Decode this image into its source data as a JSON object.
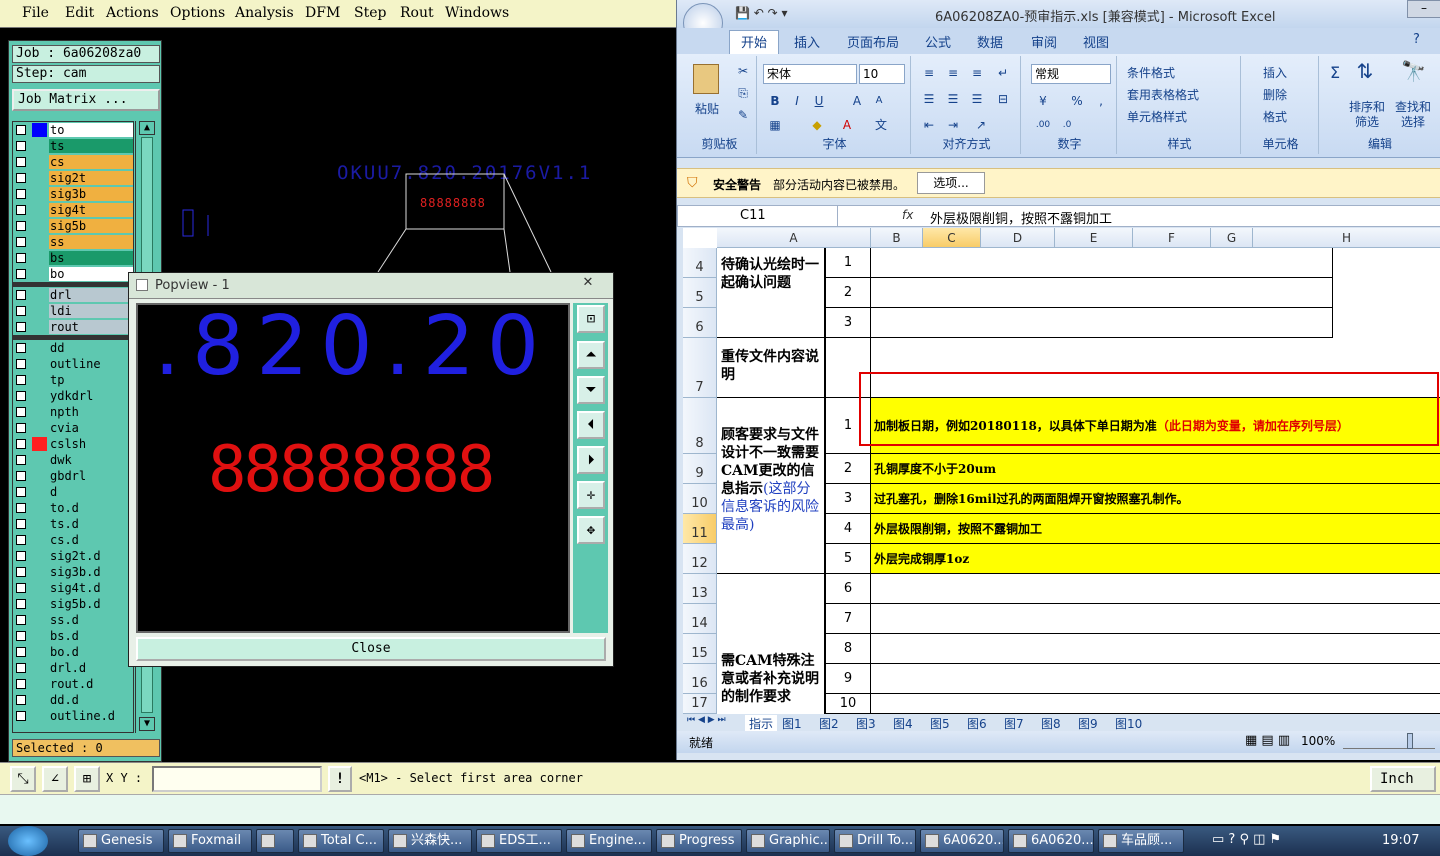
{
  "genesis": {
    "menu": [
      "File",
      "Edit",
      "Actions",
      "Options",
      "Analysis",
      "DFM",
      "Step",
      "Rout",
      "Windows"
    ],
    "job_label": "Job : 6a06208za0",
    "step_label": "Step: cam",
    "job_matrix_button": "Job Matrix ...",
    "layers": [
      {
        "name": "to",
        "color": "#ffffff",
        "marker": "#0000ff"
      },
      {
        "name": "ts",
        "color": "#1a9a6a"
      },
      {
        "name": "cs",
        "color": "#f0b040"
      },
      {
        "name": "sig2t",
        "color": "#f0b040"
      },
      {
        "name": "sig3b",
        "color": "#f0b040"
      },
      {
        "name": "sig4t",
        "color": "#f0b040"
      },
      {
        "name": "sig5b",
        "color": "#f0b040"
      },
      {
        "name": "ss",
        "color": "#f0b040"
      },
      {
        "name": "bs",
        "color": "#1a9a6a"
      },
      {
        "name": "bo",
        "color": "#ffffff"
      },
      {
        "name": "drl",
        "color": "#b8c8d0"
      },
      {
        "name": "ldi",
        "color": "#b8c8d0"
      },
      {
        "name": "rout",
        "color": "#b8c8d0"
      },
      {
        "name": "dd",
        "color": "#5ec8b0"
      },
      {
        "name": "outline",
        "color": "#5ec8b0"
      },
      {
        "name": "tp",
        "color": "#5ec8b0"
      },
      {
        "name": "ydkdrl",
        "color": "#5ec8b0"
      },
      {
        "name": "npth",
        "color": "#5ec8b0"
      },
      {
        "name": "cvia",
        "color": "#5ec8b0"
      },
      {
        "name": "cslsh",
        "color": "#5ec8b0",
        "marker": "#ff2020"
      },
      {
        "name": "dwk",
        "color": "#5ec8b0"
      },
      {
        "name": "gbdrl",
        "color": "#5ec8b0"
      },
      {
        "name": "d",
        "color": "#5ec8b0"
      },
      {
        "name": "to.d",
        "color": "#5ec8b0"
      },
      {
        "name": "ts.d",
        "color": "#5ec8b0"
      },
      {
        "name": "cs.d",
        "color": "#5ec8b0"
      },
      {
        "name": "sig2t.d",
        "color": "#5ec8b0"
      },
      {
        "name": "sig3b.d",
        "color": "#5ec8b0"
      },
      {
        "name": "sig4t.d",
        "color": "#5ec8b0"
      },
      {
        "name": "sig5b.d",
        "color": "#5ec8b0"
      },
      {
        "name": "ss.d",
        "color": "#5ec8b0"
      },
      {
        "name": "bs.d",
        "color": "#5ec8b0"
      },
      {
        "name": "bo.d",
        "color": "#5ec8b0"
      },
      {
        "name": "drl.d",
        "color": "#5ec8b0"
      },
      {
        "name": "rout.d",
        "color": "#5ec8b0"
      },
      {
        "name": "dd.d",
        "color": "#5ec8b0"
      },
      {
        "name": "outline.d",
        "color": "#5ec8b0"
      }
    ],
    "selected_label": "Selected : 0",
    "canvas_text": "OKUU7.820.20176V1.1",
    "canvas_red_text": "88888888",
    "xy_label": "X Y :",
    "prompt": "<M1> - Select first area corner",
    "units": "Inch"
  },
  "popview": {
    "title": "Popview - 1",
    "big_text": ".820.20",
    "red_text": "88888888",
    "close_label": "Close"
  },
  "excel": {
    "title": "6A06208ZA0-预审指示.xls [兼容模式] - Microsoft Excel",
    "tabs": [
      "开始",
      "插入",
      "页面布局",
      "公式",
      "数据",
      "审阅",
      "视图"
    ],
    "ribbon": {
      "paste": "粘贴",
      "clipboard_group": "剪贴板",
      "font_name": "宋体",
      "font_size": "10",
      "font_group": "字体",
      "align_group": "对齐方式",
      "number_format": "常规",
      "number_group": "数字",
      "cond_format": "条件格式",
      "table_format": "套用表格格式",
      "cell_style": "单元格样式",
      "style_group": "样式",
      "insert": "插入",
      "delete": "删除",
      "format": "格式",
      "cells_group": "单元格",
      "sort_filter": "排序和筛选",
      "find_select": "查找和选择",
      "edit_group": "编辑"
    },
    "security_label": "安全警告",
    "security_text": "部分活动内容已被禁用。",
    "options_button": "选项...",
    "name_box": "C11",
    "fx": "fx",
    "formula": "外层极限削铜，按照不露铜加工",
    "columns": [
      "A",
      "B",
      "C",
      "D",
      "E",
      "F",
      "G",
      "H"
    ],
    "rows": [
      {
        "num": "4",
        "b": "1"
      },
      {
        "num": "5",
        "b": "2"
      },
      {
        "num": "6",
        "b": "3"
      },
      {
        "num": "7",
        "b": ""
      },
      {
        "num": "8",
        "b": "1"
      },
      {
        "num": "9",
        "b": "2"
      },
      {
        "num": "10",
        "b": "3"
      },
      {
        "num": "11",
        "b": "4"
      },
      {
        "num": "12",
        "b": "5"
      },
      {
        "num": "13",
        "b": "6"
      },
      {
        "num": "14",
        "b": "7"
      },
      {
        "num": "15",
        "b": "8"
      },
      {
        "num": "16",
        "b": "9"
      },
      {
        "num": "17",
        "b": "10"
      }
    ],
    "a_confirm": "待确认光绘时一起确认问题",
    "a_reupload": "重传文件内容说明",
    "a_customer_black": "顾客要求与文件设计不一致需要CAM更改的信息指示",
    "a_customer_blue": "(这部分信息客诉的风险最高)",
    "a_special": "需CAM特殊注意或者补充说明的制作要求",
    "notes": [
      {
        "text": "加制板日期，例如20180118，以具体下单日期为准",
        "red": "（此日期为变量，请加在序列号层）"
      },
      {
        "text": "孔铜厚度不小于20um",
        "red": ""
      },
      {
        "text": "过孔塞孔，删除16mil过孔的两面阻焊开窗按照塞孔制作。",
        "red": ""
      },
      {
        "text": "外层极限削铜，按照不露铜加工",
        "red": ""
      },
      {
        "text": "外层完成铜厚1oz",
        "red": ""
      }
    ],
    "sheets": [
      "指示",
      "图1",
      "图2",
      "图3",
      "图4",
      "图5",
      "图6",
      "图7",
      "图8",
      "图9",
      "图10"
    ],
    "status_ready": "就绪",
    "zoom": "100%"
  },
  "taskbar": {
    "items": [
      "Genesis",
      "Foxmail",
      "",
      "Total C...",
      "兴森快...",
      "EDS工...",
      "Engine...",
      "Progress",
      "Graphic...",
      "Drill To...",
      "6A0620...",
      "6A0620...",
      "车品顾..."
    ],
    "clock": "19:07"
  }
}
